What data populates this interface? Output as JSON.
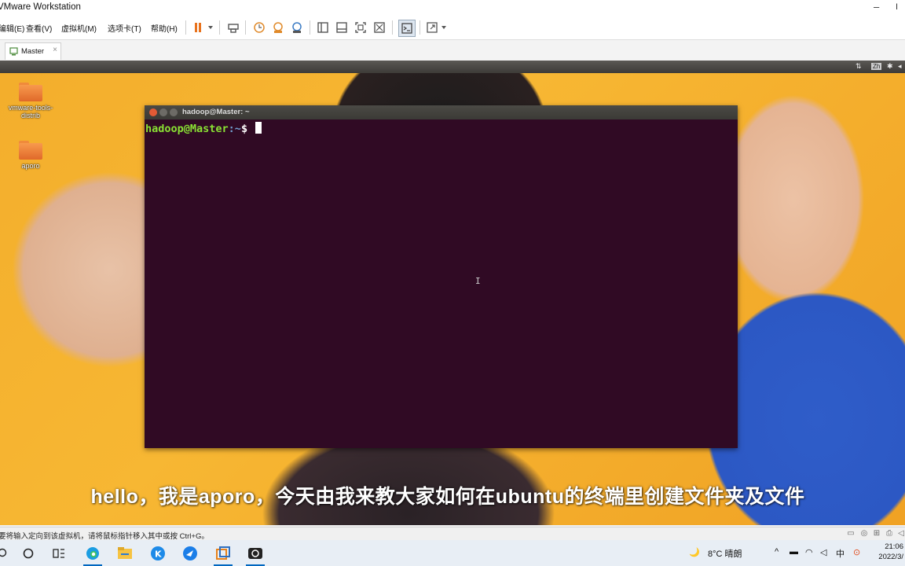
{
  "window": {
    "title": "VMware Workstation",
    "min_icon": "minimize-icon",
    "close_label": "I"
  },
  "menu": {
    "items": [
      "编辑(E)",
      "查看(V)",
      "虚拟机(M)",
      "选项卡(T)",
      "帮助(H)"
    ]
  },
  "toolbar": {
    "icons": [
      "pause-icon",
      "send-ctrl-alt-del-icon",
      "snapshot-icon",
      "revert-snapshot-icon",
      "manage-snapshots-icon",
      "library-icon",
      "thumbnail-icon",
      "fullscreen-icon",
      "unity-icon",
      "console-icon",
      "stretch-icon"
    ]
  },
  "tabs": [
    {
      "label": "Master",
      "close": "×"
    }
  ],
  "vm_strip": {
    "indicators": [
      "⇅",
      "Zh",
      "✱",
      "◂"
    ]
  },
  "desktop": {
    "icons": [
      {
        "label": "vmware-tools-distrib"
      },
      {
        "label": "aporo"
      }
    ]
  },
  "terminal": {
    "title": "hadoop@Master: ~",
    "prompt_user": "hadoop@Master",
    "prompt_path": ":~",
    "prompt_symbol": "$ ",
    "ibeam": "I",
    "colors": {
      "background": "#300a24",
      "user": "#8ae234",
      "path": "#729fcf"
    }
  },
  "subtitle": "hello，我是aporo，今天由我来教大家如何在ubuntu的终端里创建文件夹及文件",
  "statusbar": {
    "text": "要将输入定向到该虚拟机，请将鼠标指针移入其中或按 Ctrl+G。"
  },
  "taskbar": {
    "weather": "8°C 晴朗",
    "ime": "中",
    "time": "21:06",
    "date": "2022/3/"
  }
}
